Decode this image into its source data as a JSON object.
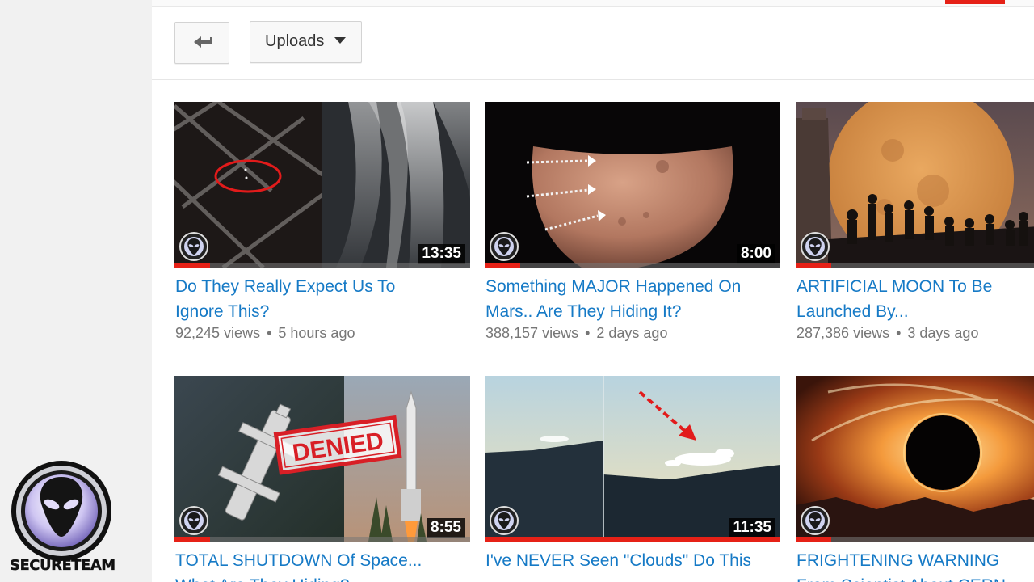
{
  "toolbar": {
    "back_icon": "back-arrow-icon",
    "uploads_label": "Uploads",
    "uploads_icon": "caret-down-icon"
  },
  "videos": [
    {
      "title": "Do They Really Expect Us To Ignore This?",
      "views": "92,245 views",
      "age": "5 hours ago",
      "duration": "13:35",
      "watched_fraction": 0.12
    },
    {
      "title": "Something MAJOR Happened On Mars.. Are They Hiding It?",
      "views": "388,157 views",
      "age": "2 days ago",
      "duration": "8:00",
      "watched_fraction": 0.12
    },
    {
      "title": "ARTIFICIAL MOON To Be Launched By...",
      "views": "287,386 views",
      "age": "3 days ago",
      "duration": "",
      "watched_fraction": 0.12
    },
    {
      "title": "TOTAL SHUTDOWN Of Space... What Are They Hiding?",
      "views": "",
      "age": "",
      "duration": "8:55",
      "watched_fraction": 0.12,
      "overlay_text": "DENIED"
    },
    {
      "title": "I've NEVER Seen \"Clouds\" Do This",
      "views": "",
      "age": "",
      "duration": "11:35",
      "watched_fraction": 1.0
    },
    {
      "title": "FRIGHTENING WARNING From Scientist About CERN",
      "views": "",
      "age": "",
      "duration": "",
      "watched_fraction": 0.12
    }
  ],
  "watermark": {
    "text": "SECURETEAM",
    "icon": "alien-head-icon"
  },
  "colors": {
    "link": "#167ac6",
    "progress": "#e62117",
    "meta": "#767676"
  }
}
